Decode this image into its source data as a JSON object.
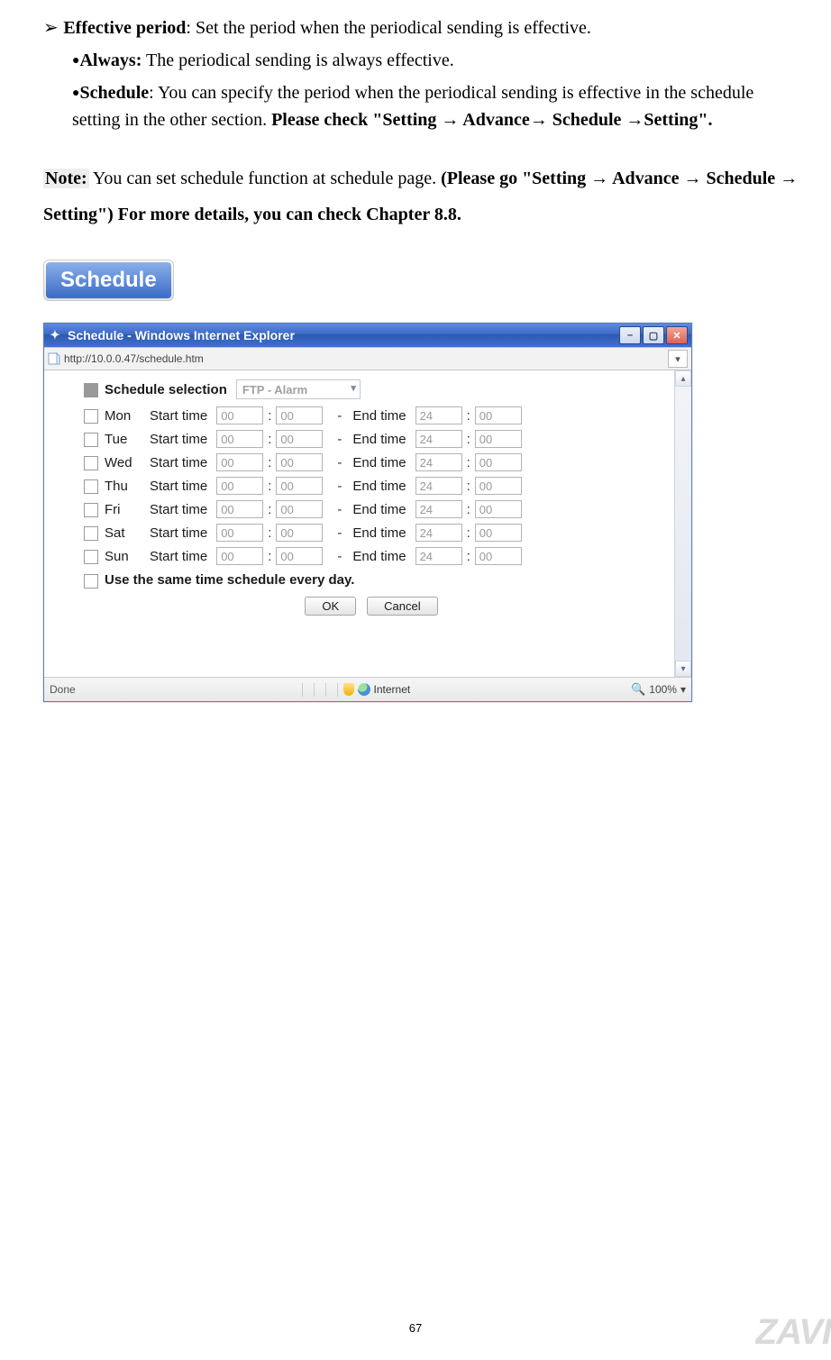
{
  "doc": {
    "effective_period_label": "Effective period",
    "effective_period_text": ": Set the period when the periodical sending is effective.",
    "always_label": "Always:",
    "always_text": " The periodical sending is always effective.",
    "schedule_label": "Schedule",
    "schedule_text": ": You can specify the period when the periodical sending is effective in the schedule setting in the other section. ",
    "schedule_bold": "Please check \"Setting → Advance→ Schedule →Setting\".",
    "note_label": "Note:",
    "note_text": " You can set schedule function at schedule page. ",
    "note_bold": "(Please go \"Setting → Advance → Schedule → Setting\") For more details, you can check Chapter 8.8.",
    "tab_label": "Schedule",
    "page_number": "67",
    "watermark": "ZAVI"
  },
  "window": {
    "title": "Schedule - Windows Internet Explorer",
    "url": "http://10.0.0.47/schedule.htm",
    "section_label": "Schedule selection",
    "select_value": "FTP - Alarm",
    "start_label": "Start time",
    "end_label": "End time",
    "days": [
      {
        "name": "Mon",
        "sh": "00",
        "sm": "00",
        "eh": "24",
        "em": "00"
      },
      {
        "name": "Tue",
        "sh": "00",
        "sm": "00",
        "eh": "24",
        "em": "00"
      },
      {
        "name": "Wed",
        "sh": "00",
        "sm": "00",
        "eh": "24",
        "em": "00"
      },
      {
        "name": "Thu",
        "sh": "00",
        "sm": "00",
        "eh": "24",
        "em": "00"
      },
      {
        "name": "Fri",
        "sh": "00",
        "sm": "00",
        "eh": "24",
        "em": "00"
      },
      {
        "name": "Sat",
        "sh": "00",
        "sm": "00",
        "eh": "24",
        "em": "00"
      },
      {
        "name": "Sun",
        "sh": "00",
        "sm": "00",
        "eh": "24",
        "em": "00"
      }
    ],
    "same_every_day": "Use the same time schedule every day.",
    "ok": "OK",
    "cancel": "Cancel",
    "status_done": "Done",
    "status_zone": "Internet",
    "zoom": "100%"
  }
}
